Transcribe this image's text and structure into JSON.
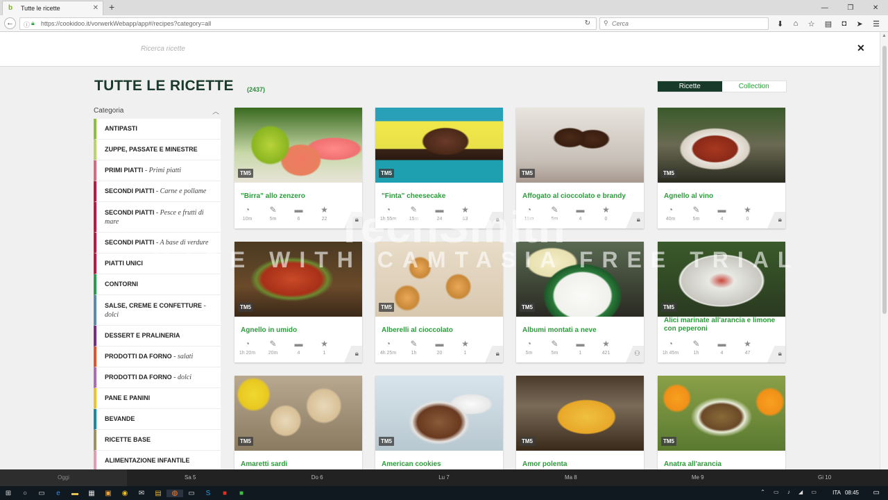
{
  "browser": {
    "tab_title": "Tutte le ricette",
    "tab_favicon": "b",
    "url": "https://cookidoo.it/vorwerkWebapp/app#/recipes?category=all",
    "search_placeholder": "Cerca"
  },
  "app": {
    "search_placeholder": "Ricerca ricette",
    "page_title": "TUTTE LE RICETTE",
    "recipe_count": "(2437)",
    "toggle": {
      "recipes": "Ricette",
      "collections": "Collection"
    },
    "category_label": "Categoria"
  },
  "categories": [
    {
      "name": "ANTIPASTI",
      "sub": "",
      "color": "#8cbf3f"
    },
    {
      "name": "ZUPPE, PASSATE E MINESTRE",
      "sub": "",
      "color": "#b8d46b"
    },
    {
      "name": "PRIMI PIATTI",
      "sub": " - Primi piatti",
      "color": "#e0667a"
    },
    {
      "name": "SECONDI PIATTI",
      "sub": " - Carne e pollame",
      "color": "#c8143c"
    },
    {
      "name": "SECONDI PIATTI",
      "sub": " - Pesce e frutti di mare",
      "color": "#c8143c"
    },
    {
      "name": "SECONDI PIATTI",
      "sub": " - A base di verdure",
      "color": "#c8143c"
    },
    {
      "name": "PIATTI UNICI",
      "sub": "",
      "color": "#c8143c"
    },
    {
      "name": "CONTORNI",
      "sub": "",
      "color": "#2a9d4a"
    },
    {
      "name": "SALSE, CREME E CONFETTURE",
      "sub": " - dolci",
      "color": "#5a8ab0"
    },
    {
      "name": "DESSERT E PRALINERIA",
      "sub": "",
      "color": "#7a2a8a"
    },
    {
      "name": "PRODOTTI DA FORNO",
      "sub": " - salati",
      "color": "#e8502a"
    },
    {
      "name": "PRODOTTI DA FORNO",
      "sub": " - dolci",
      "color": "#b06ab8"
    },
    {
      "name": "PANE E PANINI",
      "sub": "",
      "color": "#f0c030"
    },
    {
      "name": "BEVANDE",
      "sub": "",
      "color": "#1a8aa0"
    },
    {
      "name": "RICETTE BASE",
      "sub": "",
      "color": "#a09060"
    },
    {
      "name": "ALIMENTAZIONE INFANTILE",
      "sub": "",
      "color": "#e89ab0"
    }
  ],
  "recipes": [
    {
      "title": "\"Birra\" allo zenzero",
      "badge": "TM5",
      "time": "10m",
      "prep": "5m",
      "portions": "6",
      "rating": "22"
    },
    {
      "title": "\"Finta\" cheesecake",
      "badge": "TM5",
      "time": "1h 55m",
      "prep": "15m",
      "portions": "24",
      "rating": "63"
    },
    {
      "title": "Affogato al cioccolato e brandy",
      "badge": "TM5",
      "time": "15m",
      "prep": "5m",
      "portions": "4",
      "rating": "0"
    },
    {
      "title": "Agnello al vino",
      "badge": "TM5",
      "time": "40m",
      "prep": "5m",
      "portions": "4",
      "rating": "0"
    },
    {
      "title": "Agnello in umido",
      "badge": "TM5",
      "time": "1h 20m",
      "prep": "20m",
      "portions": "4",
      "rating": "1"
    },
    {
      "title": "Alberelli al cioccolato",
      "badge": "TM5",
      "time": "4h 25m",
      "prep": "1h",
      "portions": "20",
      "rating": "1"
    },
    {
      "title": "Albumi montati a neve",
      "badge": "TM5",
      "time": "5m",
      "prep": "5m",
      "portions": "1",
      "rating": "421"
    },
    {
      "title": "Alici marinate all'arancia e limone con peperoni",
      "badge": "TM5",
      "time": "1h 45m",
      "prep": "1h",
      "portions": "4",
      "rating": "47"
    },
    {
      "title": "Amaretti sardi",
      "badge": "TM5"
    },
    {
      "title": "American cookies",
      "badge": "TM5"
    },
    {
      "title": "Amor polenta",
      "badge": "TM5"
    },
    {
      "title": "Anatra all'arancia",
      "badge": "TM5"
    }
  ],
  "watermark": {
    "line1": "TechSmith",
    "line2": "MADE WITH CAMTASIA FREE TRIAL"
  },
  "calendar": [
    "Oggi",
    "Sa 5",
    "Do 6",
    "Lu 7",
    "Ma 8",
    "Me 9",
    "Gi 10"
  ],
  "tray": {
    "lang": "ITA",
    "time": "08:45"
  },
  "colors": {
    "brand_green": "#2a9d3a",
    "dark_green": "#173a2b"
  }
}
